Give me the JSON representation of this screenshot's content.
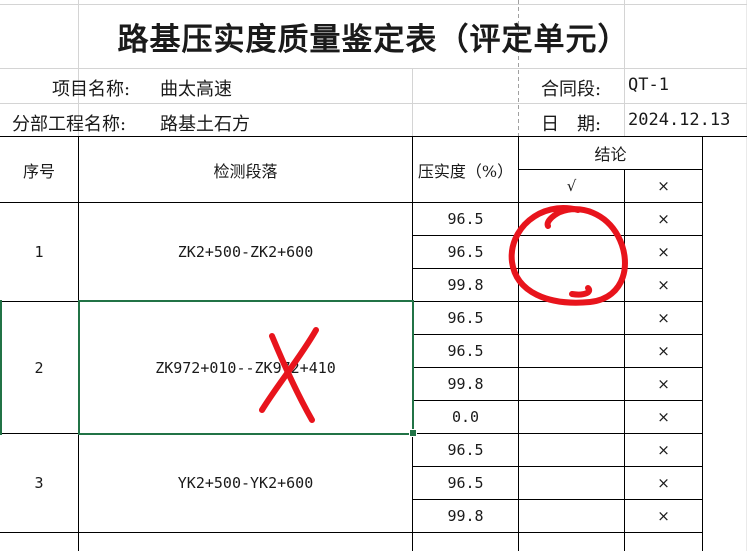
{
  "sheet": {
    "title": "路基压实度质量鉴定表（评定单元）",
    "project_label": "项目名称:",
    "project_value": "曲太高速",
    "contract_label": "合同段:",
    "contract_value": "QT-1",
    "subproject_label": "分部工程名称:",
    "subproject_value": "路基土石方",
    "date_label": "日　期:",
    "date_value": "2024.12.13"
  },
  "table": {
    "headers": {
      "seq": "序号",
      "section": "检测段落",
      "compaction": "压实度（%）",
      "conclusion": "结论",
      "pass": "√",
      "fail": "×"
    },
    "groups": [
      {
        "seq": "1",
        "section": "ZK2+500-ZK2+600",
        "values": [
          "96.5",
          "96.5",
          "99.8"
        ]
      },
      {
        "seq": "2",
        "section": "ZK972+010--ZK972+410",
        "values": [
          "96.5",
          "96.5",
          "99.8",
          "0.0"
        ]
      },
      {
        "seq": "3",
        "section": "YK2+500-YK2+600",
        "values": [
          "96.5",
          "96.5",
          "99.8"
        ]
      }
    ],
    "fail_mark": "×"
  },
  "colors": {
    "grid": "#d4d4d4",
    "border": "#000000",
    "selection": "#217346",
    "annotation": "#e8141c"
  }
}
